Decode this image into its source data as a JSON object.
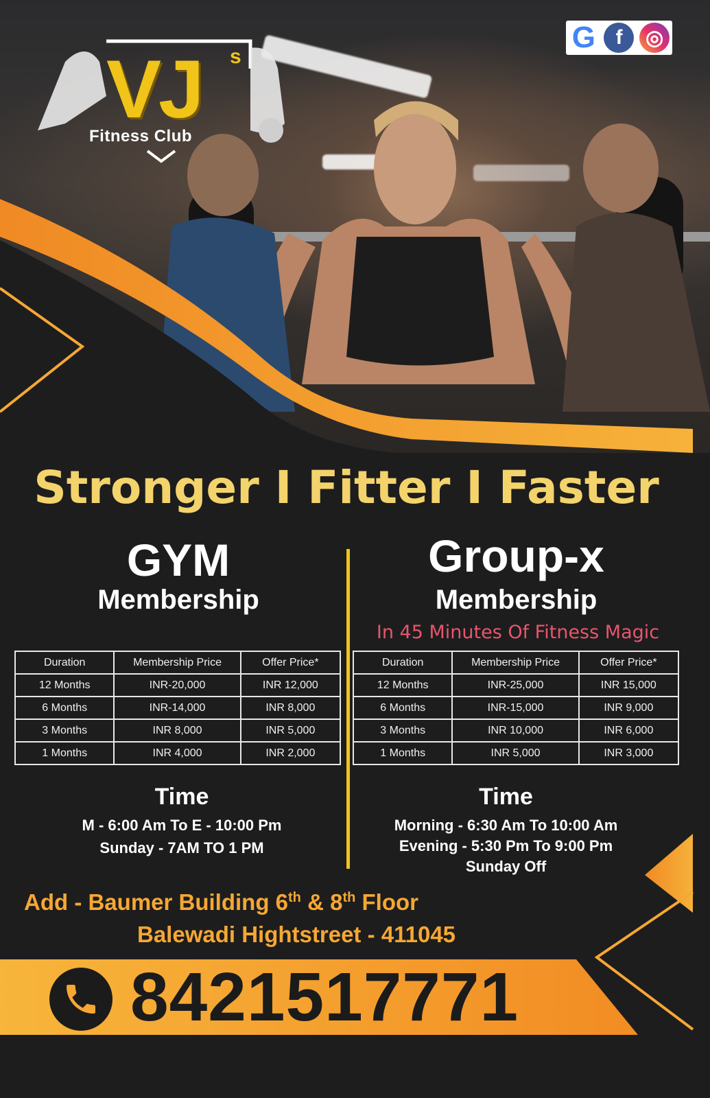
{
  "brand": {
    "logo_text": "VJ",
    "logo_sup": "s",
    "logo_sub": "Fitness Club"
  },
  "social_icons": [
    "google-icon",
    "facebook-icon",
    "instagram-icon"
  ],
  "social_glyphs": {
    "google": "G",
    "facebook": "f",
    "instagram": "◎"
  },
  "headline": "Stronger I Fitter I Faster",
  "gym": {
    "title": "GYM",
    "subtitle": "Membership",
    "table": {
      "headers": [
        "Duration",
        "Membership Price",
        "Offer Price*"
      ],
      "rows": [
        [
          "12 Months",
          "INR-20,000",
          "INR 12,000"
        ],
        [
          "6 Months",
          "INR-14,000",
          "INR 8,000"
        ],
        [
          "3 Months",
          "INR 8,000",
          "INR 5,000"
        ],
        [
          "1 Months",
          "INR 4,000",
          "INR 2,000"
        ]
      ]
    },
    "time_title": "Time",
    "time_lines": [
      "M - 6:00 Am To E - 10:00 Pm",
      "Sunday - 7AM TO 1 PM"
    ]
  },
  "groupx": {
    "title": "Group-x",
    "subtitle": "Membership",
    "tagline": "In 45 Minutes Of Fitness Magic",
    "table": {
      "headers": [
        "Duration",
        "Membership Price",
        "Offer Price*"
      ],
      "rows": [
        [
          "12 Months",
          "INR-25,000",
          "INR 15,000"
        ],
        [
          "6 Months",
          "INR-15,000",
          "INR 9,000"
        ],
        [
          "3 Months",
          "INR 10,000",
          "INR 6,000"
        ],
        [
          "1 Months",
          "INR 5,000",
          "INR 3,000"
        ]
      ]
    },
    "time_title": "Time",
    "time_lines": [
      "Morning - 6:30 Am To 10:00 Am",
      "Evening - 5:30 Pm To 9:00 Pm",
      "Sunday Off"
    ]
  },
  "address": {
    "line1_a": "Add - Baumer Building 6",
    "line1_sup1": "th",
    "line1_b": " & 8",
    "line1_sup2": "th",
    "line1_c": " Floor",
    "line2": "Balewadi Hightstreet - 411045"
  },
  "phone": "8421517771",
  "colors": {
    "accent_orange": "#f6a733",
    "accent_yellow": "#f0c419",
    "headline_yellow": "#f3d36b",
    "tagline_pink": "#e8566b",
    "background": "#1d1d1e"
  }
}
